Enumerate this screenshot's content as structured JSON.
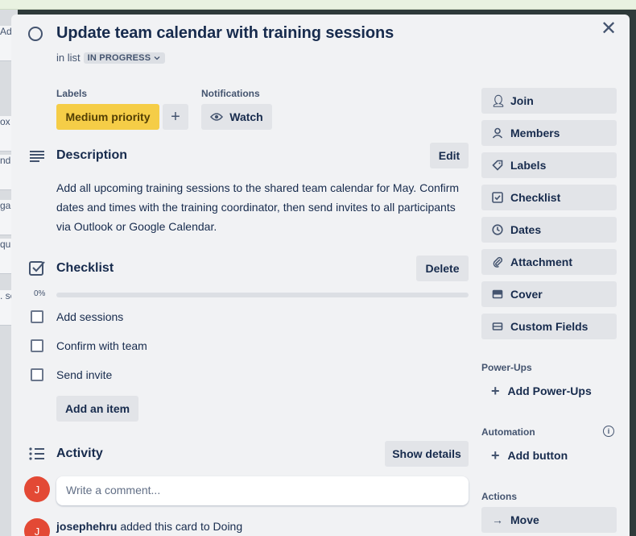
{
  "card": {
    "title": "Update team calendar with training sessions",
    "in_list_prefix": "in list",
    "list_name": "IN PROGRESS"
  },
  "labels": {
    "heading": "Labels",
    "items": [
      {
        "text": "Medium priority",
        "color": "#f5cd47"
      }
    ],
    "add_icon": "plus-icon"
  },
  "notifications": {
    "heading": "Notifications",
    "watch_label": "Watch"
  },
  "description": {
    "heading": "Description",
    "edit_label": "Edit",
    "lines": [
      "Add all upcoming training sessions to the shared team calendar for May. Confirm",
      "dates and times with the training coordinator, then send invites to all participants",
      "via Outlook or Google Calendar."
    ]
  },
  "checklist": {
    "heading": "Checklist",
    "delete_label": "Delete",
    "progress_text": "0%",
    "progress": 0,
    "items": [
      {
        "label": "Add sessions",
        "checked": false
      },
      {
        "label": "Confirm with team",
        "checked": false
      },
      {
        "label": "Send invite",
        "checked": false
      }
    ],
    "add_item_label": "Add an item"
  },
  "activity": {
    "heading": "Activity",
    "show_details_label": "Show details",
    "comment_placeholder": "Write a comment...",
    "avatar_initial": "J",
    "entries": [
      {
        "user": "josephehru",
        "text": " added this card to Doing"
      }
    ]
  },
  "sidebar": {
    "add_to_card": [
      {
        "label": "Join",
        "icon": "person-add-icon"
      },
      {
        "label": "Members",
        "icon": "person-icon"
      },
      {
        "label": "Labels",
        "icon": "tag-icon"
      },
      {
        "label": "Checklist",
        "icon": "checklist-icon"
      },
      {
        "label": "Dates",
        "icon": "clock-icon"
      },
      {
        "label": "Attachment",
        "icon": "paperclip-icon"
      },
      {
        "label": "Cover",
        "icon": "cover-icon"
      },
      {
        "label": "Custom Fields",
        "icon": "custom-fields-icon"
      }
    ],
    "powerups_heading": "Power-Ups",
    "add_powerups_label": "Add Power-Ups",
    "automation_heading": "Automation",
    "add_button_label": "Add button",
    "actions_heading": "Actions",
    "move_label": "Move"
  },
  "background": {
    "card_snippets": [
      "ox",
      "nd",
      "ga",
      "qu",
      ". se",
      "Ad"
    ]
  },
  "colors": {
    "accent": "#f5cd47",
    "avatar": "#e34935",
    "modal_bg": "#f1f2f4"
  }
}
